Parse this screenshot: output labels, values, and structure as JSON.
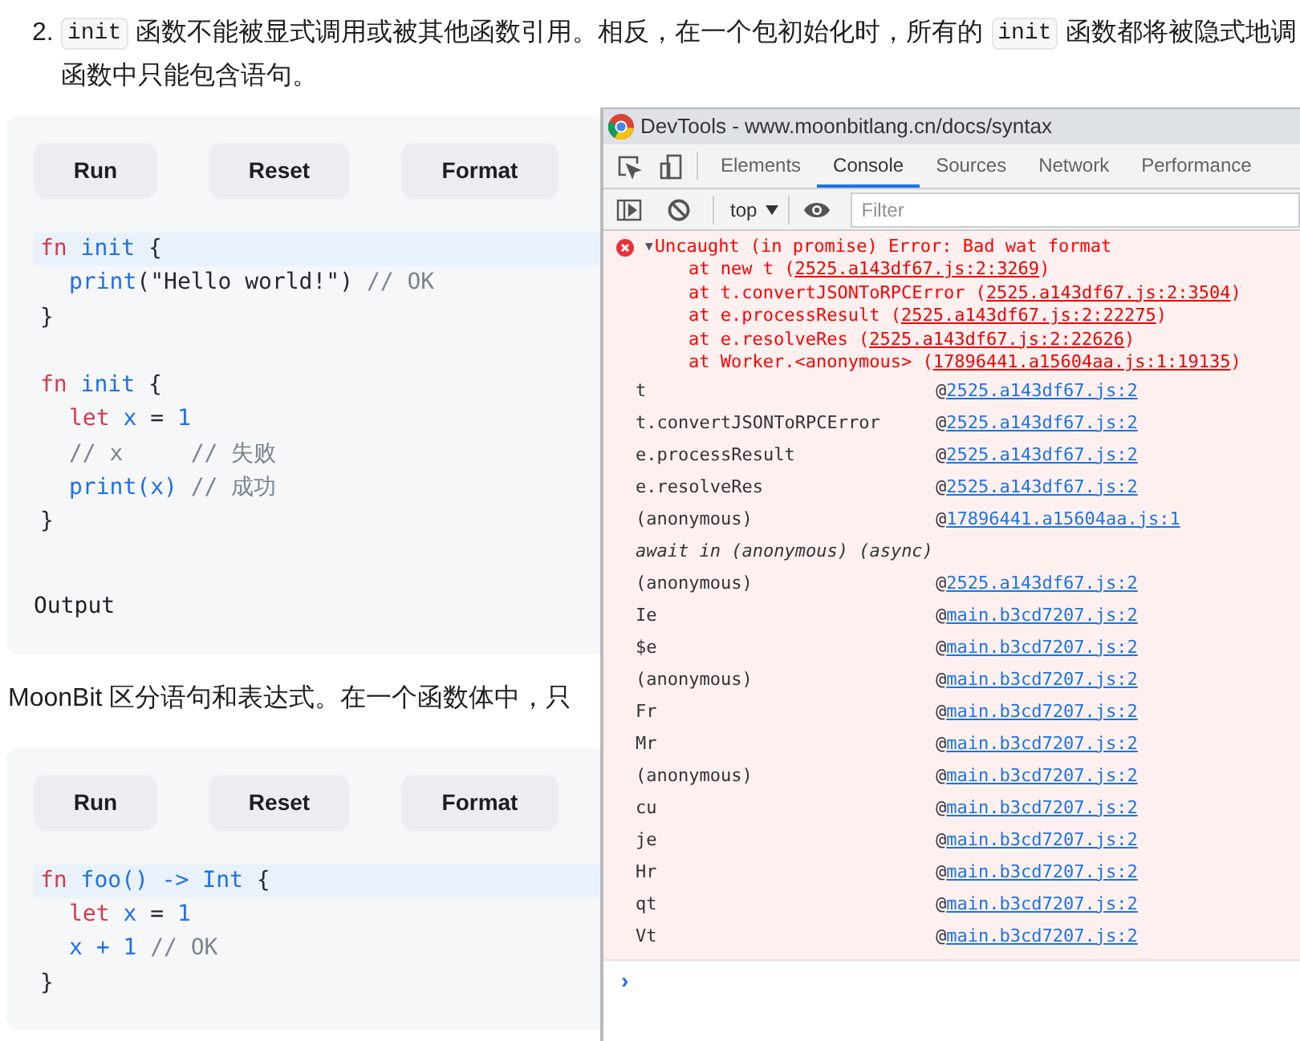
{
  "doc": {
    "list_number": "2.",
    "paragraph_lines": [
      [
        {
          "kind": "code",
          "text": "init"
        },
        {
          "kind": "text",
          "text": "函数不能被显式调用或被其他函数引用。相反，在一个包初始化时，所有的"
        },
        {
          "kind": "code",
          "text": "init"
        },
        {
          "kind": "text",
          "text": "函数都将被隐式地调"
        }
      ],
      [
        {
          "kind": "text",
          "text": "函数中只能包含语句。"
        }
      ]
    ],
    "paragraph2": "MoonBit 区分语句和表达式。在一个函数体中，只",
    "code_blocks": [
      {
        "buttons": [
          "Run",
          "Reset",
          "Format"
        ],
        "output_label": "Output",
        "functions": [
          {
            "header": {
              "highlighted": true,
              "tokens": [
                {
                  "kind": "kw",
                  "text": "fn"
                },
                {
                  "kind": "id",
                  "text": " init"
                },
                {
                  "kind": "plain",
                  "text": " {"
                }
              ]
            },
            "body": [
              {
                "highlighted": false,
                "tokens": [
                  {
                    "kind": "id",
                    "text": "print"
                  },
                  {
                    "kind": "plain",
                    "text": "(\"Hello world!\")"
                  },
                  {
                    "kind": "comment",
                    "text": " // OK"
                  }
                ]
              }
            ],
            "close": {
              "highlighted": false,
              "tokens": [
                {
                  "kind": "plain",
                  "text": "}"
                }
              ]
            }
          },
          {
            "header": {
              "highlighted": false,
              "tokens": [
                {
                  "kind": "kw",
                  "text": "fn"
                },
                {
                  "kind": "id",
                  "text": " init"
                },
                {
                  "kind": "plain",
                  "text": " {"
                }
              ]
            },
            "body": [
              {
                "highlighted": false,
                "tokens": [
                  {
                    "kind": "kw",
                    "text": "let"
                  },
                  {
                    "kind": "id",
                    "text": " x"
                  },
                  {
                    "kind": "plain",
                    "text": " ="
                  },
                  {
                    "kind": "id",
                    "text": " 1"
                  }
                ]
              },
              {
                "highlighted": false,
                "tokens": [
                  {
                    "kind": "comment",
                    "text": "// x     // 失败"
                  }
                ]
              },
              {
                "highlighted": false,
                "tokens": [
                  {
                    "kind": "id",
                    "text": "print(x)"
                  },
                  {
                    "kind": "comment",
                    "text": " // 成功"
                  }
                ]
              }
            ],
            "close": {
              "highlighted": false,
              "tokens": [
                {
                  "kind": "plain",
                  "text": "}"
                }
              ]
            }
          }
        ]
      },
      {
        "buttons": [
          "Run",
          "Reset",
          "Format"
        ],
        "functions": [
          {
            "header": {
              "highlighted": true,
              "tokens": [
                {
                  "kind": "kw",
                  "text": "fn"
                },
                {
                  "kind": "id",
                  "text": " foo() -> Int"
                },
                {
                  "kind": "plain",
                  "text": " {"
                }
              ]
            },
            "body": [
              {
                "highlighted": false,
                "tokens": [
                  {
                    "kind": "kw",
                    "text": "let"
                  },
                  {
                    "kind": "id",
                    "text": " x"
                  },
                  {
                    "kind": "plain",
                    "text": " ="
                  },
                  {
                    "kind": "id",
                    "text": " 1"
                  }
                ]
              },
              {
                "highlighted": false,
                "tokens": [
                  {
                    "kind": "id",
                    "text": "x + 1"
                  },
                  {
                    "kind": "comment",
                    "text": " // OK"
                  }
                ]
              }
            ],
            "close": {
              "highlighted": false,
              "tokens": [
                {
                  "kind": "plain",
                  "text": "}"
                }
              ]
            }
          }
        ]
      }
    ]
  },
  "devtools": {
    "title": "DevTools - www.moonbitlang.cn/docs/syntax",
    "tabs": [
      {
        "label": "Elements",
        "selected": false
      },
      {
        "label": "Console",
        "selected": true
      },
      {
        "label": "Sources",
        "selected": false
      },
      {
        "label": "Network",
        "selected": false
      },
      {
        "label": "Performance",
        "selected": false
      }
    ],
    "context": "top",
    "filter_placeholder": "Filter",
    "error": {
      "toggle": "▼",
      "message": "Uncaught (in promise) Error: Bad wat format",
      "stack": [
        {
          "text": "at new t (",
          "link": "2525.a143df67.js:2:3269",
          "close": ")"
        },
        {
          "text": "at t.convertJSONToRPCError (",
          "link": "2525.a143df67.js:2:3504",
          "close": ")"
        },
        {
          "text": "at e.processResult (",
          "link": "2525.a143df67.js:2:22275",
          "close": ")"
        },
        {
          "text": "at e.resolveRes (",
          "link": "2525.a143df67.js:2:22626",
          "close": ")"
        },
        {
          "text": "at Worker.<anonymous> (",
          "link": "17896441.a15604aa.js:1:19135",
          "close": ")"
        }
      ],
      "frames": [
        {
          "kind": "frame",
          "function": "t",
          "at": "@",
          "link": "2525.a143df67.js:2"
        },
        {
          "kind": "frame",
          "function": "t.convertJSONToRPCError",
          "at": "@",
          "link": "2525.a143df67.js:2"
        },
        {
          "kind": "frame",
          "function": "e.processResult",
          "at": "@",
          "link": "2525.a143df67.js:2"
        },
        {
          "kind": "frame",
          "function": "e.resolveRes",
          "at": "@",
          "link": "2525.a143df67.js:2"
        },
        {
          "kind": "frame",
          "function": "(anonymous)",
          "at": "@",
          "link": "17896441.a15604aa.js:1"
        },
        {
          "kind": "async",
          "label": "await in (anonymous) (async)"
        },
        {
          "kind": "frame",
          "function": "(anonymous)",
          "at": "@",
          "link": "2525.a143df67.js:2"
        },
        {
          "kind": "frame",
          "function": "Ie",
          "at": "@",
          "link": "main.b3cd7207.js:2"
        },
        {
          "kind": "frame",
          "function": "$e",
          "at": "@",
          "link": "main.b3cd7207.js:2"
        },
        {
          "kind": "frame",
          "function": "(anonymous)",
          "at": "@",
          "link": "main.b3cd7207.js:2"
        },
        {
          "kind": "frame",
          "function": "Fr",
          "at": "@",
          "link": "main.b3cd7207.js:2"
        },
        {
          "kind": "frame",
          "function": "Mr",
          "at": "@",
          "link": "main.b3cd7207.js:2"
        },
        {
          "kind": "frame",
          "function": "(anonymous)",
          "at": "@",
          "link": "main.b3cd7207.js:2"
        },
        {
          "kind": "frame",
          "function": "cu",
          "at": "@",
          "link": "main.b3cd7207.js:2"
        },
        {
          "kind": "frame",
          "function": "je",
          "at": "@",
          "link": "main.b3cd7207.js:2"
        },
        {
          "kind": "frame",
          "function": "Hr",
          "at": "@",
          "link": "main.b3cd7207.js:2"
        },
        {
          "kind": "frame",
          "function": "qt",
          "at": "@",
          "link": "main.b3cd7207.js:2"
        },
        {
          "kind": "frame",
          "function": "Vt",
          "at": "@",
          "link": "main.b3cd7207.js:2"
        }
      ]
    },
    "prompt": "›"
  }
}
